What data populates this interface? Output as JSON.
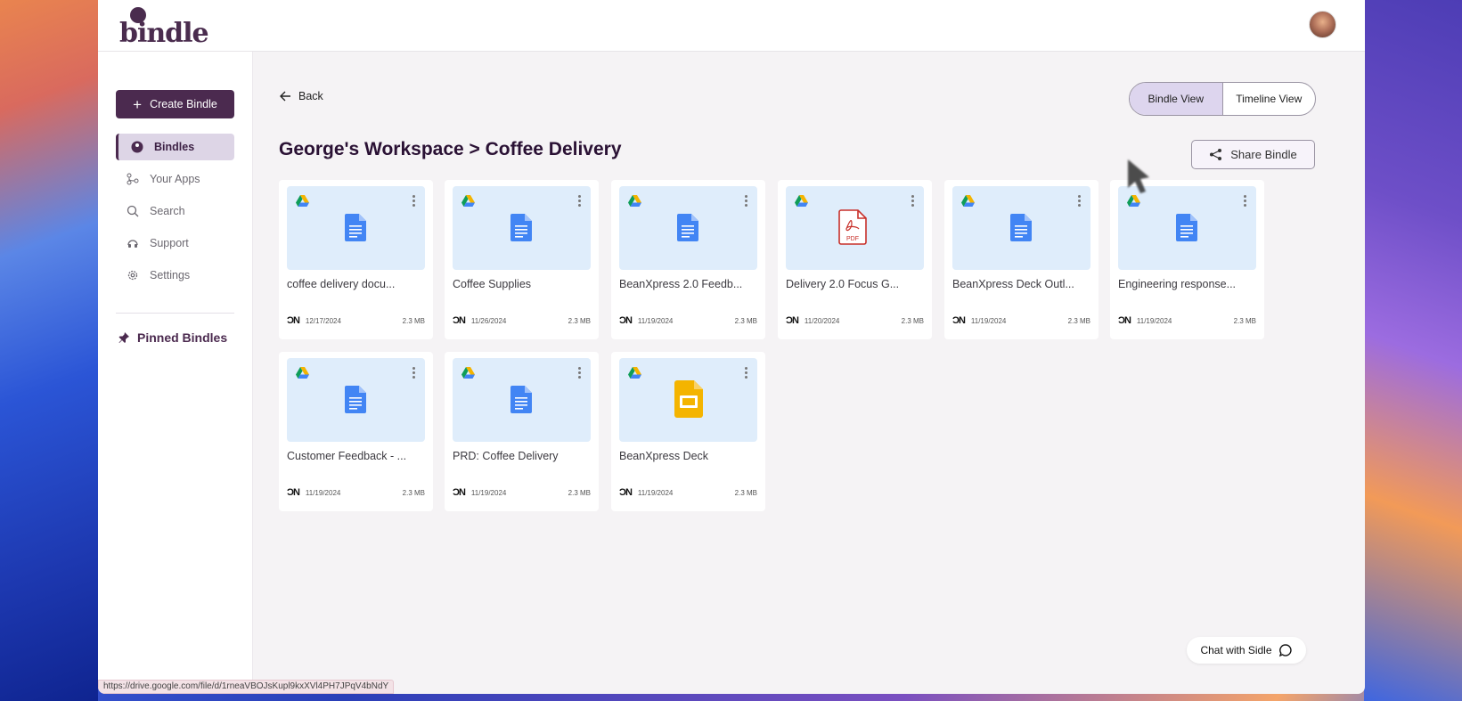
{
  "app": {
    "logo_text": "bindle"
  },
  "sidebar": {
    "create_label": "Create Bindle",
    "items": [
      {
        "label": "Bindles",
        "icon": "bindle-globe-icon"
      },
      {
        "label": "Your Apps",
        "icon": "apps-branch-icon"
      },
      {
        "label": "Search",
        "icon": "search-icon"
      },
      {
        "label": "Support",
        "icon": "support-icon"
      },
      {
        "label": "Settings",
        "icon": "gear-icon"
      }
    ],
    "pinned_label": "Pinned Bindles"
  },
  "main": {
    "back_label": "Back",
    "views": [
      "Bindle View",
      "Timeline View"
    ],
    "title": "George's Workspace > Coffee Delivery",
    "share_label": "Share Bindle"
  },
  "files": [
    {
      "name": "coffee delivery docu...",
      "date": "12/17/2024",
      "size": "2.3 MB",
      "type": "doc",
      "owner": "ƆN"
    },
    {
      "name": "Coffee Supplies",
      "date": "11/26/2024",
      "size": "2.3 MB",
      "type": "doc",
      "owner": "ƆN"
    },
    {
      "name": "BeanXpress 2.0 Feedb...",
      "date": "11/19/2024",
      "size": "2.3 MB",
      "type": "doc",
      "owner": "ƆN"
    },
    {
      "name": "Delivery 2.0 Focus G...",
      "date": "11/20/2024",
      "size": "2.3 MB",
      "type": "pdf",
      "owner": "ƆN"
    },
    {
      "name": "BeanXpress Deck Outl...",
      "date": "11/19/2024",
      "size": "2.3 MB",
      "type": "doc",
      "owner": "ƆN"
    },
    {
      "name": "Engineering response...",
      "date": "11/19/2024",
      "size": "2.3 MB",
      "type": "doc",
      "owner": "ƆN"
    },
    {
      "name": "Customer Feedback - ...",
      "date": "11/19/2024",
      "size": "2.3 MB",
      "type": "doc",
      "owner": "ƆN"
    },
    {
      "name": "PRD: Coffee Delivery",
      "date": "11/19/2024",
      "size": "2.3 MB",
      "type": "doc",
      "owner": "ƆN"
    },
    {
      "name": "BeanXpress Deck",
      "date": "11/19/2024",
      "size": "2.3 MB",
      "type": "slides",
      "owner": "ƆN"
    }
  ],
  "chat_label": "Chat with Sidle",
  "status_url": "https://drive.google.com/file/d/1rneaVBOJsKupl9kxXVl4PH7JPqV4bNdY",
  "colors": {
    "brand": "#4b2a4f",
    "thumb_bg": "#dfedfb",
    "doc_blue": "#4285f4",
    "pdf_red": "#c8302a",
    "slides_yellow": "#f4b400"
  }
}
